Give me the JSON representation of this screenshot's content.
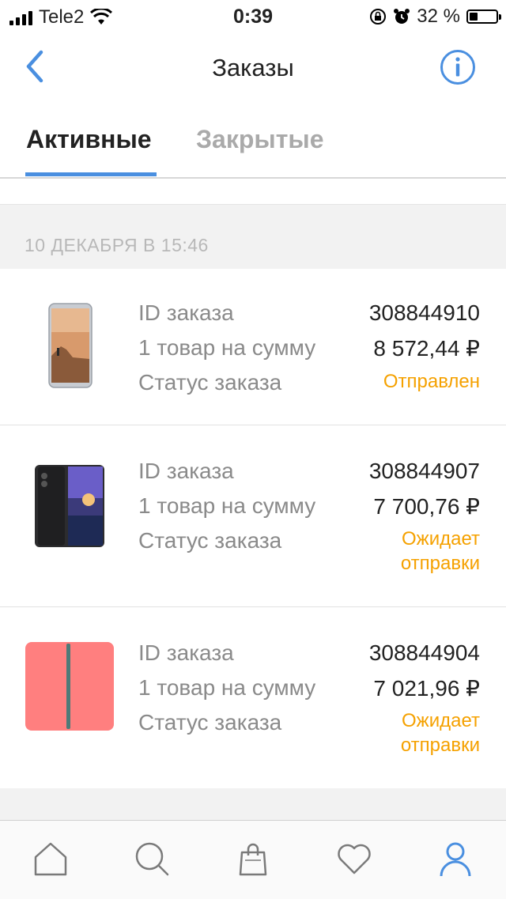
{
  "status_bar": {
    "carrier": "Tele2",
    "time": "0:39",
    "battery": "32 %",
    "battery_level": 0.32
  },
  "nav": {
    "title": "Заказы",
    "back_icon": "chevron-left-icon",
    "info_icon": "info-icon"
  },
  "tabs": [
    {
      "label": "Активные",
      "active": true
    },
    {
      "label": "Закрытые",
      "active": false
    }
  ],
  "section": {
    "date": "10 ДЕКАБРЯ В 15:46"
  },
  "orders": [
    {
      "id_label": "ID заказа",
      "id": "308844910",
      "sum_label": "1 товар на сумму",
      "sum": "8 572,44 ₽",
      "status_label": "Статус заказа",
      "status": "Отправлен"
    },
    {
      "id_label": "ID заказа",
      "id": "308844907",
      "sum_label": "1 товар на сумму",
      "sum": "7 700,76 ₽",
      "status_label": "Статус заказа",
      "status": "Ожидает отправки"
    },
    {
      "id_label": "ID заказа",
      "id": "308844904",
      "sum_label": "1 товар на сумму",
      "sum": "7 021,96 ₽",
      "status_label": "Статус заказа",
      "status": "Ожидает отправки"
    }
  ],
  "tab_bar": [
    {
      "icon": "home-icon",
      "active": false
    },
    {
      "icon": "search-icon",
      "active": false
    },
    {
      "icon": "shopping-bag-icon",
      "active": false
    },
    {
      "icon": "heart-icon",
      "active": false
    },
    {
      "icon": "profile-icon",
      "active": true
    }
  ],
  "colors": {
    "accent": "#4a8fe0",
    "status": "#f5a100",
    "inactive_tab": "#aaaaaa"
  }
}
